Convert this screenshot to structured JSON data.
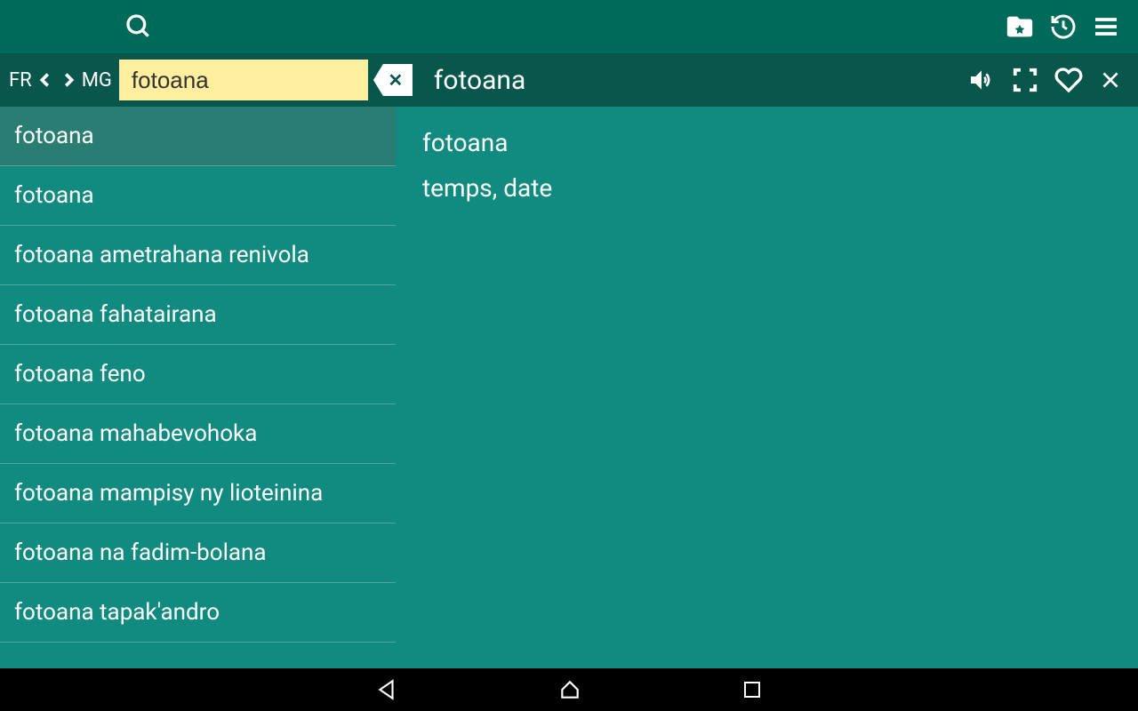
{
  "search": {
    "lang_from": "FR",
    "lang_to": "MG",
    "value": "fotoana"
  },
  "detail_header": {
    "title": "fotoana"
  },
  "results": [
    "fotoana",
    "fotoana",
    "fotoana ametrahana renivola",
    "fotoana fahatairana",
    "fotoana feno",
    "fotoana mahabevohoka",
    "fotoana mampisy ny lioteinina",
    "fotoana na fadim-bolana",
    "fotoana tapak'andro"
  ],
  "selected_index": 0,
  "definition": {
    "word": "fotoana",
    "meaning": "temps, date"
  }
}
